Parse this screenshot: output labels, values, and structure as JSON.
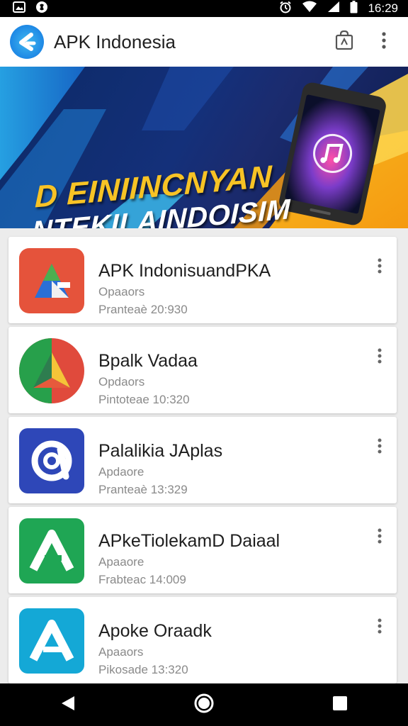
{
  "status_bar": {
    "time": "16:29",
    "icons": [
      "gallery-notification-icon",
      "app-notification-icon",
      "alarm-icon",
      "wifi-icon",
      "signal-icon",
      "battery-icon"
    ]
  },
  "app_bar": {
    "title": "APK Indonesia",
    "actions": [
      "shopping-bag-icon",
      "more-vert-icon"
    ]
  },
  "banner": {
    "line1": "D EINIINCNYAN",
    "line2": "NTEKILAINDOISIM"
  },
  "apps": [
    {
      "name": "APK IndonisuandPKA",
      "subtitle": "Opaaors",
      "meta": "Pranteaè 20:930",
      "icon": "red-triangle-app-icon"
    },
    {
      "name": "Bpalk Vadaa",
      "subtitle": "Opdaors",
      "meta": "Pintoteae 10:320",
      "icon": "green-red-triangle-app-icon"
    },
    {
      "name": "Palalikia JAplas",
      "subtitle": "Apdaore",
      "meta": "Pranteaè 13:329",
      "icon": "blue-q-app-icon"
    },
    {
      "name": "APkeTiolekamD Daiaal",
      "subtitle": "Apaaore",
      "meta": "Frabteac 14:009",
      "icon": "green-a-app-icon"
    },
    {
      "name": "Apoke Oraadk",
      "subtitle": "Apaaors",
      "meta": "Pikosade 13:320",
      "icon": "teal-a-app-icon"
    }
  ],
  "nav_bar": [
    "back-icon",
    "home-icon",
    "recents-icon"
  ],
  "colors": {
    "app_bar_bg": "#ffffff",
    "list_bg": "#ececec",
    "banner_yellow": "#f7c325",
    "banner_navy": "#14307a",
    "accent_blue": "#1e88e5"
  }
}
